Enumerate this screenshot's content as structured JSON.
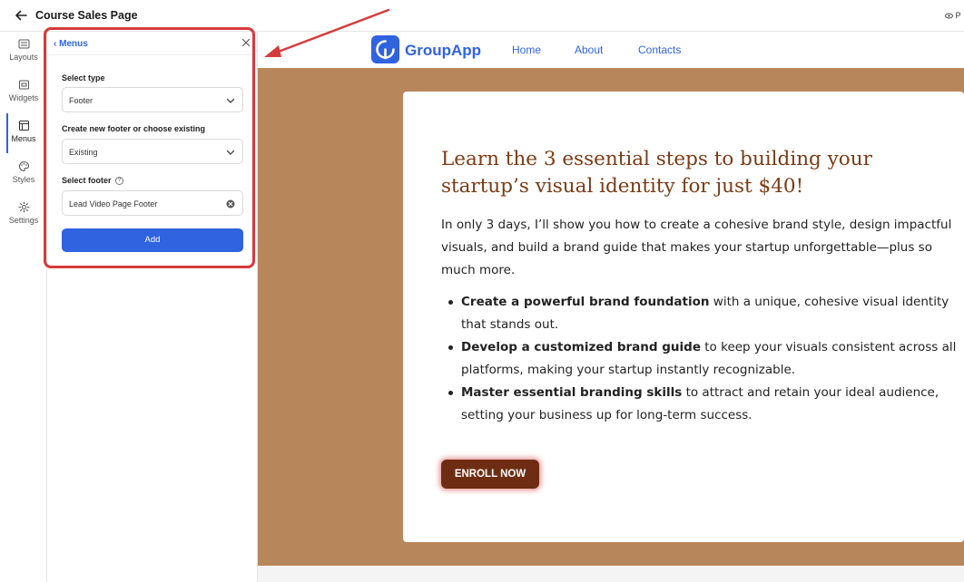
{
  "topbar": {
    "title": "Course Sales Page",
    "preview_label": "P"
  },
  "rail": {
    "items": [
      {
        "label": "Layouts",
        "icon": "layouts-icon"
      },
      {
        "label": "Widgets",
        "icon": "widgets-icon"
      },
      {
        "label": "Menus",
        "icon": "menus-icon"
      },
      {
        "label": "Styles",
        "icon": "palette-icon"
      },
      {
        "label": "Settings",
        "icon": "gear-icon"
      }
    ],
    "active": "Menus"
  },
  "panel": {
    "back_label": "Menus",
    "select_type_label": "Select type",
    "select_type_value": "Footer",
    "choose_label": "Create new footer or choose existing",
    "choose_value": "Existing",
    "select_footer_label": "Select footer",
    "select_footer_value": "Lead Video Page Footer",
    "add_label": "Add"
  },
  "site": {
    "brand": "GroupApp",
    "nav": [
      "Home",
      "About",
      "Contacts"
    ],
    "headline": "Learn the 3 essential steps to building your startup’s visual identity for just $40!",
    "intro": "In only 3 days, I’ll show you how to create a cohesive brand style, design impactful visuals, and build a brand guide that makes your startup unforgettable—plus so much more.",
    "bullets": [
      {
        "bold": "Create a powerful brand foundation",
        "rest": " with a unique, cohesive visual identity that stands out."
      },
      {
        "bold": "Develop a customized brand guide",
        "rest": " to keep your visuals consistent across all platforms, making your startup instantly recognizable."
      },
      {
        "bold": "Master essential branding skills",
        "rest": " to attract and retain your ideal audience, setting your business up for long-term success."
      }
    ],
    "cta": "ENROLL NOW"
  },
  "colors": {
    "accent": "#2f63e0",
    "hero_bg": "#b8865b",
    "headline": "#7a3b14",
    "cta_bg": "#6e2d12",
    "highlight": "#d63b3b"
  }
}
